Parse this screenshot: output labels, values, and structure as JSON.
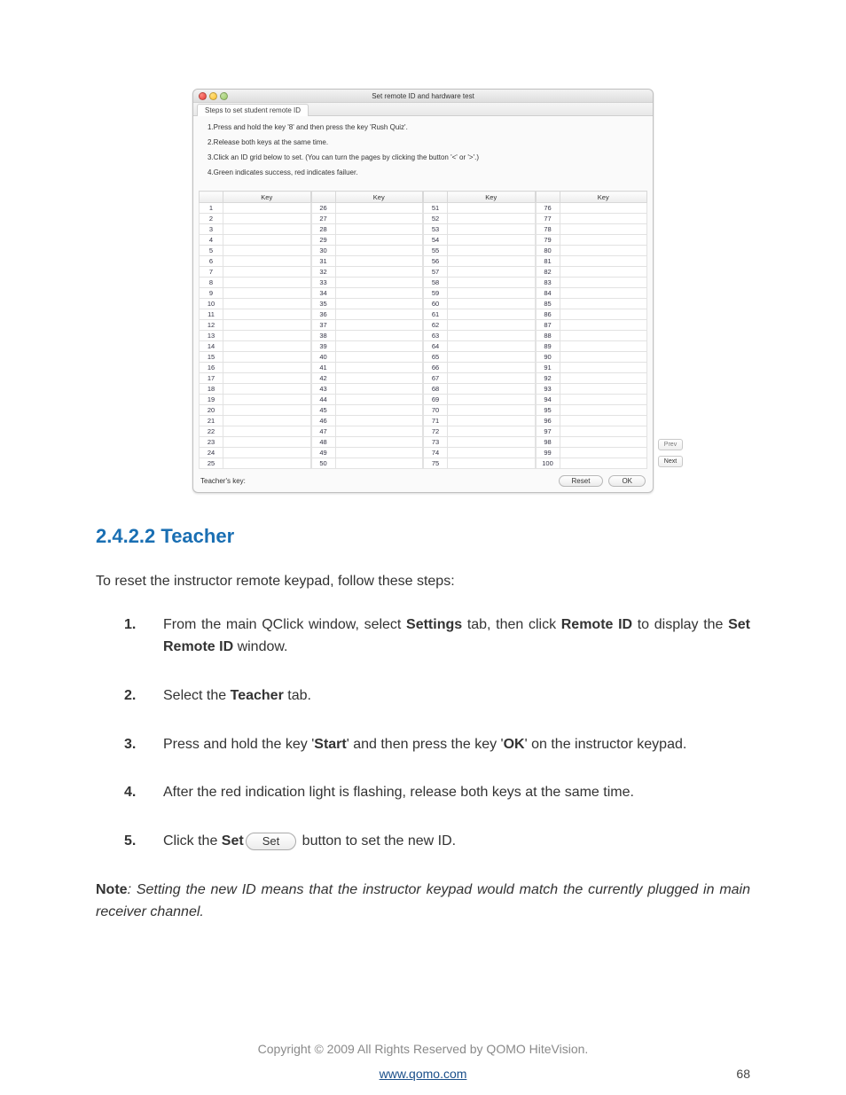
{
  "window": {
    "title": "Set remote ID and hardware test",
    "tab_label": "Steps to set student remote ID",
    "instructions": [
      "1.Press and hold the key '8' and then press the key 'Rush Quiz'.",
      "2.Release both keys at the same time.",
      "3.Click an ID grid below to set. (You can turn the pages by clicking the button '<' or '>'.)",
      "4.Green indicates success, red indicates failuer."
    ],
    "key_header": "Key",
    "columns": [
      [
        1,
        2,
        3,
        4,
        5,
        6,
        7,
        8,
        9,
        10,
        11,
        12,
        13,
        14,
        15,
        16,
        17,
        18,
        19,
        20,
        21,
        22,
        23,
        24,
        25
      ],
      [
        26,
        27,
        28,
        29,
        30,
        31,
        32,
        33,
        34,
        35,
        36,
        37,
        38,
        39,
        40,
        41,
        42,
        43,
        44,
        45,
        46,
        47,
        48,
        49,
        50
      ],
      [
        51,
        52,
        53,
        54,
        55,
        56,
        57,
        58,
        59,
        60,
        61,
        62,
        63,
        64,
        65,
        66,
        67,
        68,
        69,
        70,
        71,
        72,
        73,
        74,
        75
      ],
      [
        76,
        77,
        78,
        79,
        80,
        81,
        82,
        83,
        84,
        85,
        86,
        87,
        88,
        89,
        90,
        91,
        92,
        93,
        94,
        95,
        96,
        97,
        98,
        99,
        100
      ]
    ],
    "prev_label": "Prev",
    "next_label": "Next",
    "teacher_key_label": "Teacher's key:",
    "reset_label": "Reset",
    "ok_label": "OK"
  },
  "doc": {
    "heading": "2.4.2.2 Teacher",
    "intro": "To reset the instructor remote keypad, follow these steps:",
    "step1": {
      "pre": "From the main QClick window, select ",
      "b1": "Settings",
      "mid1": " tab, then click ",
      "b2": "Remote ID",
      "mid2": " to display the ",
      "b3": "Set Remote ID",
      "post": " window."
    },
    "step2": {
      "pre": "Select the ",
      "b1": "Teacher",
      "post": " tab."
    },
    "step3": {
      "pre": "Press and hold the key '",
      "b1": "Start",
      "mid": "' and then press the key '",
      "b2": "OK",
      "post": "' on the instructor keypad."
    },
    "step4": "After the red indication light is flashing, release both keys at the same time.",
    "step5": {
      "pre": "Click the ",
      "b1": "Set",
      "chip": "Set",
      "post": " button to set the new ID."
    },
    "note_label": "Note",
    "note_text": ": Setting the new ID means that the instructor keypad would match the currently plugged in main receiver channel.",
    "copyright": "Copyright © 2009 All Rights Reserved by QOMO HiteVision.",
    "url": "www.qomo.com",
    "page_number": "68"
  }
}
